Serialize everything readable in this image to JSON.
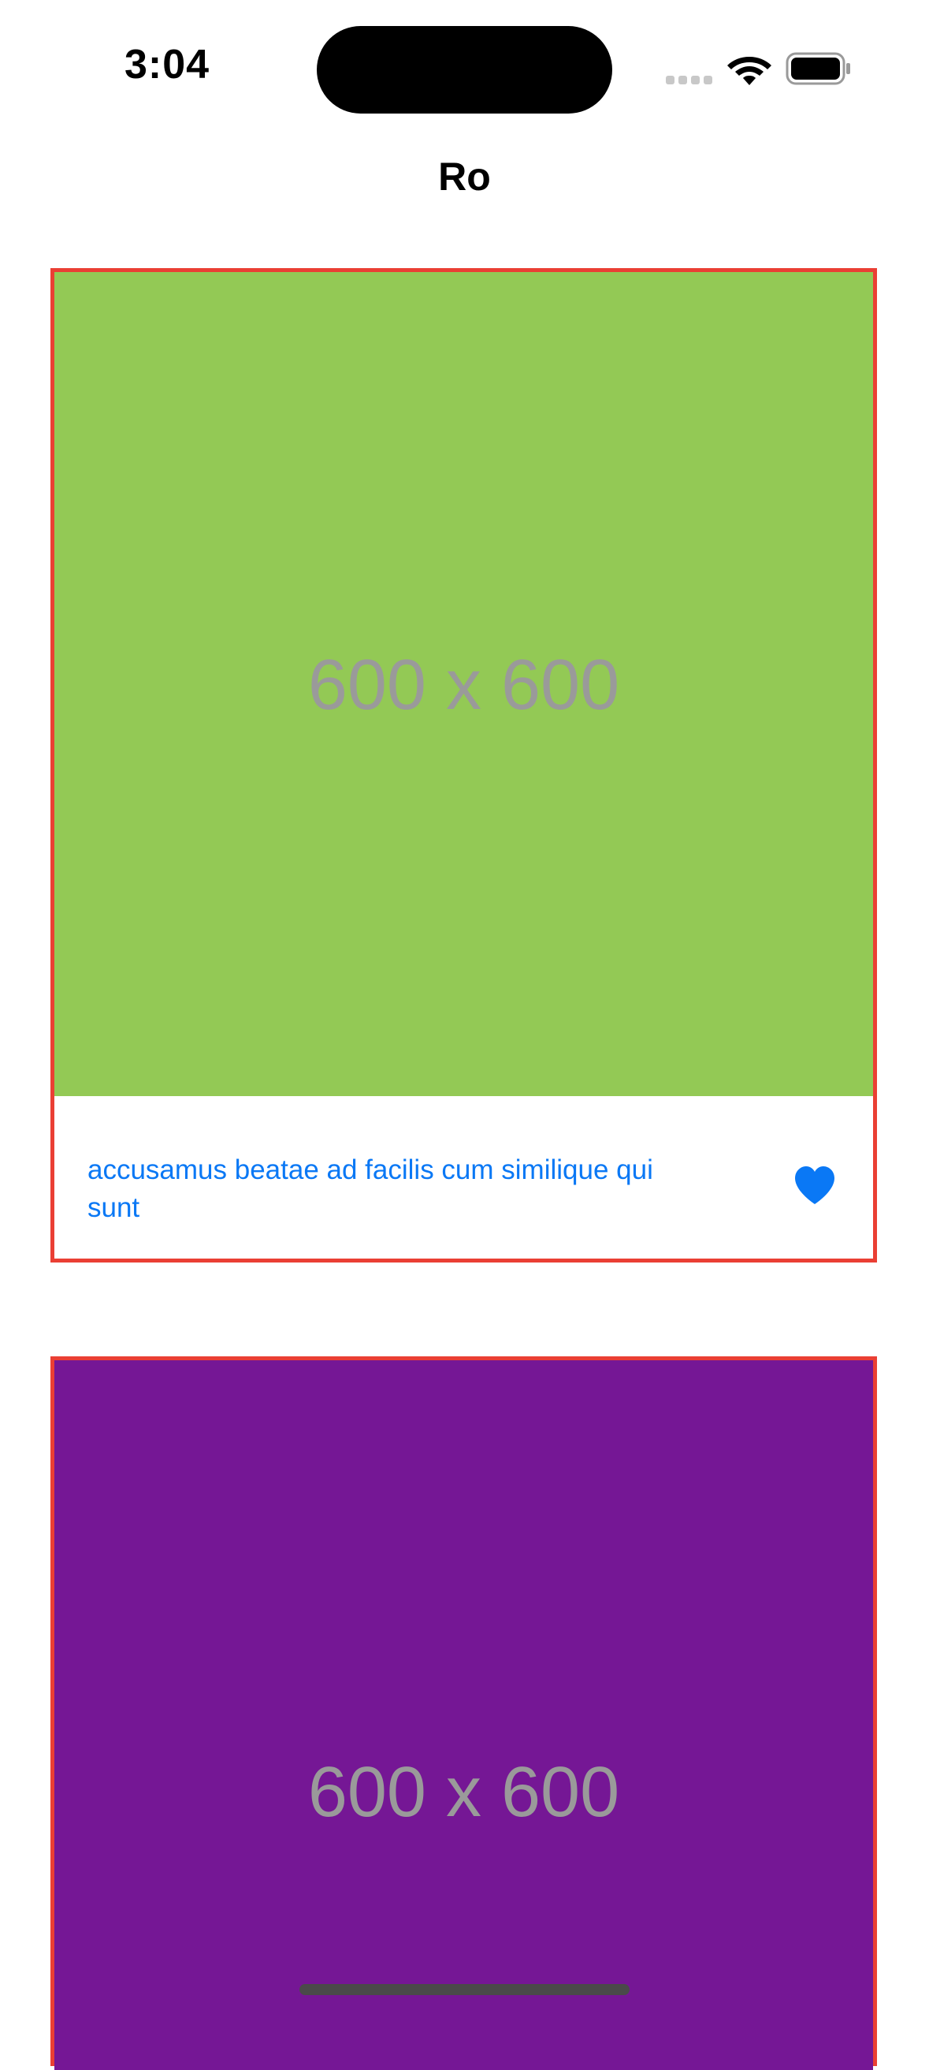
{
  "status_bar": {
    "time": "3:04"
  },
  "nav": {
    "title": "Ro"
  },
  "cards": [
    {
      "image_label": "600 x 600",
      "image_color": "#93c955",
      "caption": "accusamus beatae ad facilis cum similique qui sunt",
      "icon": "heart-filled-icon"
    },
    {
      "image_label": "600 x 600",
      "image_color": "#751795"
    }
  ],
  "colors": {
    "accent": "#0a78f5",
    "card_border": "#ea3f34"
  }
}
